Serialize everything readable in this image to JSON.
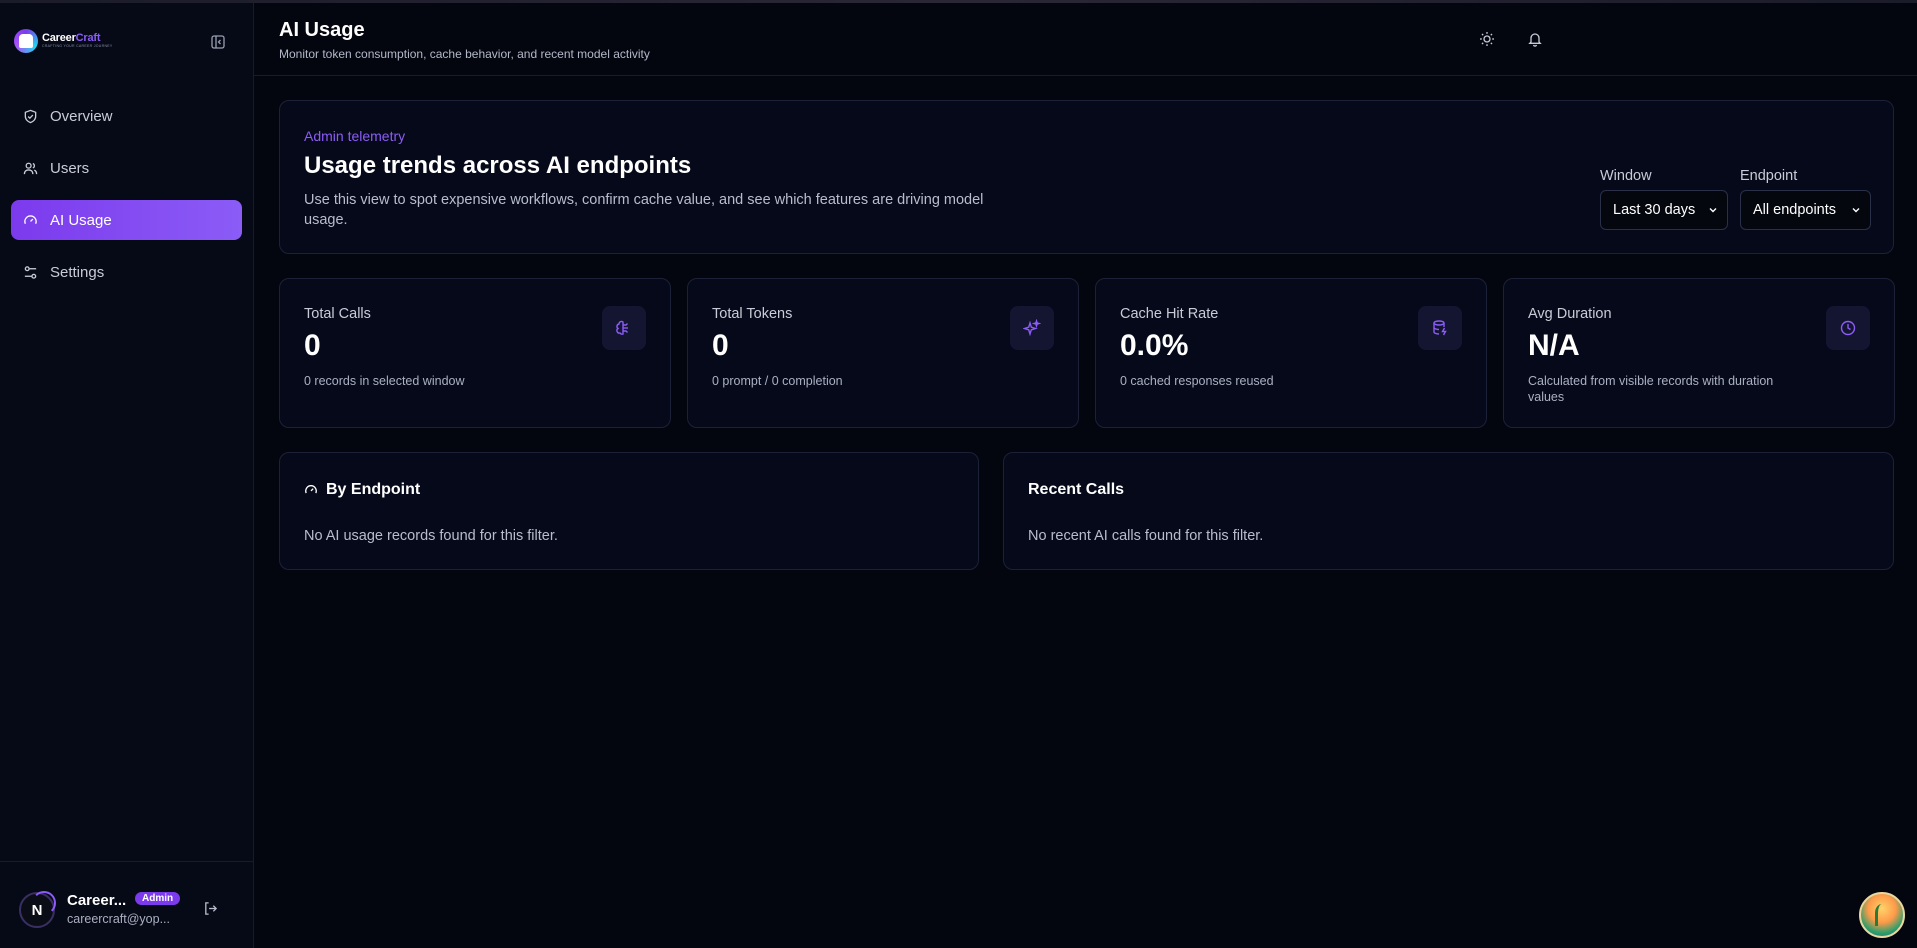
{
  "brand": {
    "name_part1": "Career",
    "name_part2": "Craft",
    "tagline": "CRAFTING YOUR CAREER JOURNEY"
  },
  "sidebar": {
    "items": [
      {
        "label": "Overview",
        "icon": "shield-check-icon",
        "active": false
      },
      {
        "label": "Users",
        "icon": "users-icon",
        "active": false
      },
      {
        "label": "AI Usage",
        "icon": "gauge-icon",
        "active": true
      },
      {
        "label": "Settings",
        "icon": "sliders-icon",
        "active": false
      }
    ]
  },
  "user": {
    "avatar_letter": "N",
    "name": "Career...",
    "role_badge": "Admin",
    "email": "careercraft@yop..."
  },
  "header": {
    "title": "AI Usage",
    "subtitle": "Monitor token consumption, cache behavior, and recent model activity"
  },
  "hero": {
    "eyebrow": "Admin telemetry",
    "title": "Usage trends across AI endpoints",
    "description": "Use this view to spot expensive workflows, confirm cache value, and see which features are driving model usage.",
    "window_label": "Window",
    "window_value": "Last 30 days",
    "endpoint_label": "Endpoint",
    "endpoint_value": "All endpoints"
  },
  "stats": [
    {
      "label": "Total Calls",
      "value": "0",
      "note": "0 records in selected window",
      "icon": "brain-icon"
    },
    {
      "label": "Total Tokens",
      "value": "0",
      "note": "0 prompt / 0 completion",
      "icon": "sparkles-icon"
    },
    {
      "label": "Cache Hit Rate",
      "value": "0.0%",
      "note": "0 cached responses reused",
      "icon": "database-zap-icon"
    },
    {
      "label": "Avg Duration",
      "value": "N/A",
      "note": "Calculated from visible records with duration values",
      "icon": "clock-icon"
    }
  ],
  "panels": {
    "by_endpoint": {
      "title": "By Endpoint",
      "empty": "No AI usage records found for this filter."
    },
    "recent_calls": {
      "title": "Recent Calls",
      "empty": "No recent AI calls found for this filter."
    }
  },
  "colors": {
    "accent": "#7c3aed",
    "background": "#04060f",
    "card": "#060919",
    "border": "#1c2138"
  }
}
